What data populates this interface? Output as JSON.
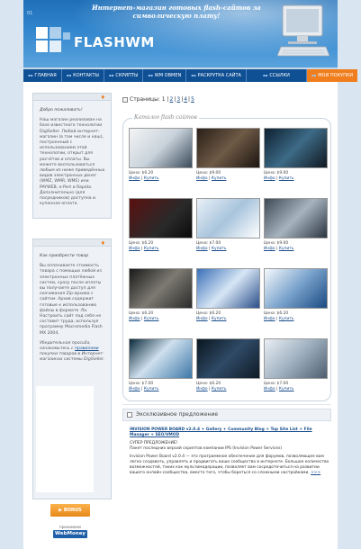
{
  "header": {
    "version": "01",
    "tagline": "Интернет-магазин готовых flash-сайтов за символическую плату!",
    "logo": "FLASHWM"
  },
  "nav": {
    "items": [
      {
        "label": "ГЛАВНАЯ"
      },
      {
        "label": "КОНТАКТЫ"
      },
      {
        "label": "СКРИПТЫ"
      },
      {
        "label": "WM OBMEN"
      },
      {
        "label": "РАСКРУТКА САЙТА"
      },
      {
        "label": "ССЫЛКИ"
      },
      {
        "label": "МОИ ПОКУПКИ"
      }
    ]
  },
  "sidebar": {
    "about": {
      "title": "Добро пожаловать!",
      "text": "Наш магазин реализован на базе известного технологии DigiSeller. Любой интернет-магазин (в том числе и наш), построенный с использованием этой технологии, открыт для расчётов и оплаты. Вы можете воспользоваться любым из ниже приведённых видов электронных денег (WMZ, WMR, WME) или PAYWEB, е-Port и Rapida. Дополнительно (для посредников) доступна и купонная оплата."
    },
    "howto": {
      "title": "Как приобрести товар",
      "text": "Вы оплачиваете стоимость товара с помощью любой из электронных платёжных систем, сразу после оплаты вы получаете доступ для скачивания Zip-архива с сайтом. Архив содержит готовые к использованию файлы в формате .fla. Настроить сайт под себя не составит труда, используя программу Macromedia Flash MX 2004.",
      "note_prefix": "Убедительная просьба, ознакомьтесь с",
      "note_link": "правилами",
      "note_suffix": "покупки товаров в Интернет-магазинах системы DigiSeller."
    },
    "bonus": "BONUS",
    "webmoney_caption": "принимаем",
    "webmoney": "WebMoney"
  },
  "main": {
    "pages_label": "Страницы: 1",
    "pages": [
      "2",
      "3",
      "4",
      "5"
    ],
    "catalog_title": "Каталог flash сайтов",
    "products": [
      {
        "price": "Цена: $6.20",
        "info": "Инфо",
        "buy": "Купить"
      },
      {
        "price": "Цена: $9.00",
        "info": "Инфо",
        "buy": "Купить"
      },
      {
        "price": "Цена: $9.00",
        "info": "Инфо",
        "buy": "Купить"
      },
      {
        "price": "Цена: $6.20",
        "info": "Инфо",
        "buy": "Купить"
      },
      {
        "price": "Цена: $7.00",
        "info": "Инфо",
        "buy": "Купить"
      },
      {
        "price": "Цена: $9.00",
        "info": "Инфо",
        "buy": "Купить"
      },
      {
        "price": "Цена: $6.20",
        "info": "Инфо",
        "buy": "Купить"
      },
      {
        "price": "Цена: $6.20",
        "info": "Инфо",
        "buy": "Купить"
      },
      {
        "price": "Цена: $6.20",
        "info": "Инфо",
        "buy": "Купить"
      },
      {
        "price": "Цена: $7.00",
        "info": "Инфо",
        "buy": "Купить"
      },
      {
        "price": "Цена: $6.20",
        "info": "Инфо",
        "buy": "Купить"
      },
      {
        "price": "Цена: $7.00",
        "info": "Инфо",
        "buy": "Купить"
      }
    ],
    "exclusive_title": "Эксклюзивное предложение",
    "exclusive_headline": "INVISION POWER BOARD v2.0.4 + Gallery + Community Blog + Top Site List + File Manager + SEO/VMOD",
    "exclusive_super": "СУПЕР ПРЕДЛОЖЕНИЕ!",
    "exclusive_line1": "Пакет последних версий скриптов компании IPS (Invision Power Services)",
    "exclusive_body": "Invision Power Board v2.0.4 — это программное обеспечение для форумов, позволяющее вам легко создавать, управлять и продвигать ваше сообщество в интернете. Большое количество возможностей, таких как мультимодерации, позволяет вам сосредоточиться на развитии вашего онлайн-сообщества, вместо того, чтобы бороться со сложными настройками.",
    "exclusive_more": ">>>"
  },
  "colors": {
    "nav_bg": "#0f4f93",
    "accent": "#f07e1d",
    "link": "#1a4e8c"
  }
}
